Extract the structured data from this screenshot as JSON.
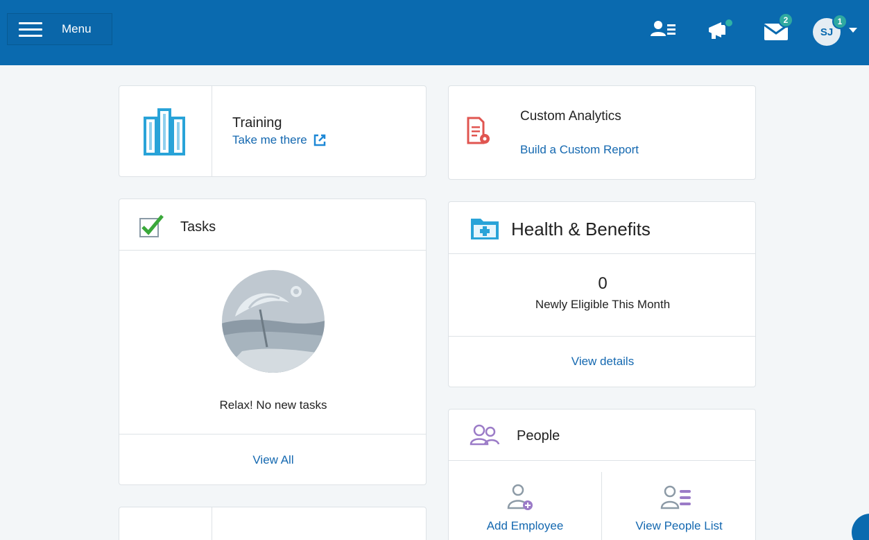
{
  "header": {
    "menu_label": "Menu",
    "messages_badge": "2",
    "avatar_initials": "SJ",
    "avatar_badge": "1"
  },
  "training": {
    "title": "Training",
    "link": "Take me there"
  },
  "analytics": {
    "title": "Custom Analytics",
    "link": "Build a Custom Report"
  },
  "tasks": {
    "title": "Tasks",
    "empty_text": "Relax! No new tasks",
    "view_all": "View All"
  },
  "health": {
    "title": "Health & Benefits",
    "count": "0",
    "count_label": "Newly Eligible This Month",
    "view_details": "View details"
  },
  "people": {
    "title": "People",
    "add_employee": "Add Employee",
    "view_list": "View People List"
  },
  "colors": {
    "brand_blue": "#0a6aaf",
    "link_blue": "#1468b0",
    "teal_badge": "#2fa9a0",
    "training_icon": "#29a3d8",
    "analytics_icon": "#e05550",
    "people_icon": "#9b7bc7",
    "tasks_check": "#3aa83a"
  }
}
